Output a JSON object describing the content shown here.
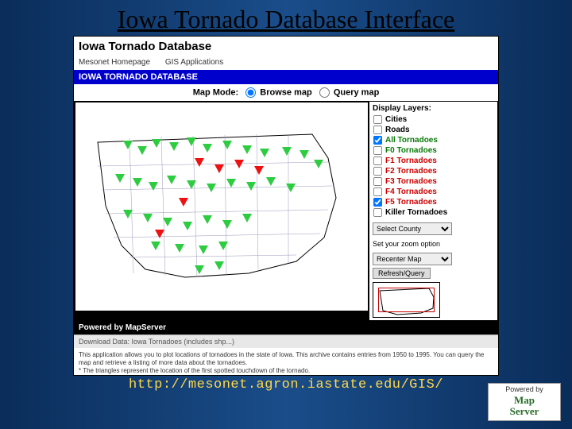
{
  "slide": {
    "title": "Iowa Tornado Database Interface"
  },
  "app": {
    "title": "Iowa Tornado Database",
    "nav": {
      "home": "Mesonet Homepage",
      "gis": "GIS Applications"
    },
    "section_header": "IOWA TORNADO DATABASE",
    "mode": {
      "label": "Map Mode:",
      "browse": "Browse map",
      "query": "Query map"
    },
    "layers": {
      "header": "Display Layers:",
      "cities": "Cities",
      "roads": "Roads",
      "all": "All Tornadoes",
      "f0": "F0 Tornadoes",
      "f1": "F1 Tornadoes",
      "f2": "F2 Tornadoes",
      "f3": "F3 Tornadoes",
      "f4": "F4 Tornadoes",
      "f5": "F5 Tornadoes",
      "killer": "Killer Tornadoes"
    },
    "county_select": {
      "placeholder": "Select County"
    },
    "zoom": {
      "label": "Set your zoom option",
      "option": "Recenter Map",
      "button": "Refresh/Query"
    },
    "powered": {
      "label": "Powered by MapServer",
      "right": ""
    },
    "download": "Download Data: Iowa Tornadoes (includes shp...)",
    "description": {
      "line1": "This application allows you to plot locations of tornadoes in the state of Iowa. This archive contains entries from 1950 to 1995. You can query the map and retrieve a listing of more data about the tornadoes.",
      "line2": "* The triangles represent the location of the first spotted touchdown of the tornado."
    }
  },
  "footer": {
    "url": "http://mesonet.agron.iastate.edu/GIS/"
  },
  "mslogo": {
    "top": "Powered by",
    "l1": "Map",
    "l2": "Server"
  }
}
